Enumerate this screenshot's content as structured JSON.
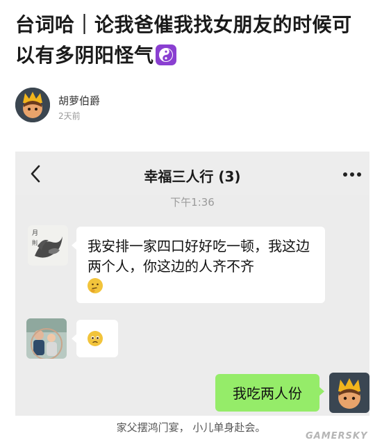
{
  "post": {
    "title": "台词哈｜论我爸催我找女朋友的时候可以有多阴阳怪气",
    "title_icon": "yin-yang-icon"
  },
  "author": {
    "name": "胡萝伯爵",
    "time": "2天前"
  },
  "chat": {
    "title": "幸福三人行 (3)",
    "timestamp": "下午1:36",
    "messages": [
      {
        "side": "left",
        "text": "我安排一家四口好好吃一顿，我这边两个人，你这边的人齐不齐",
        "emoji": "thinking-face-icon"
      },
      {
        "side": "left",
        "text": "",
        "emoji": "pleading-face-icon"
      },
      {
        "side": "right",
        "text": "我吃两人份"
      }
    ],
    "colors": {
      "background": "#ececec",
      "own_bubble": "#95ec69",
      "other_bubble": "#ffffff"
    }
  },
  "caption": "家父摆鸿门宴，  小儿单身赴会。",
  "watermark": "GAMERSKY"
}
